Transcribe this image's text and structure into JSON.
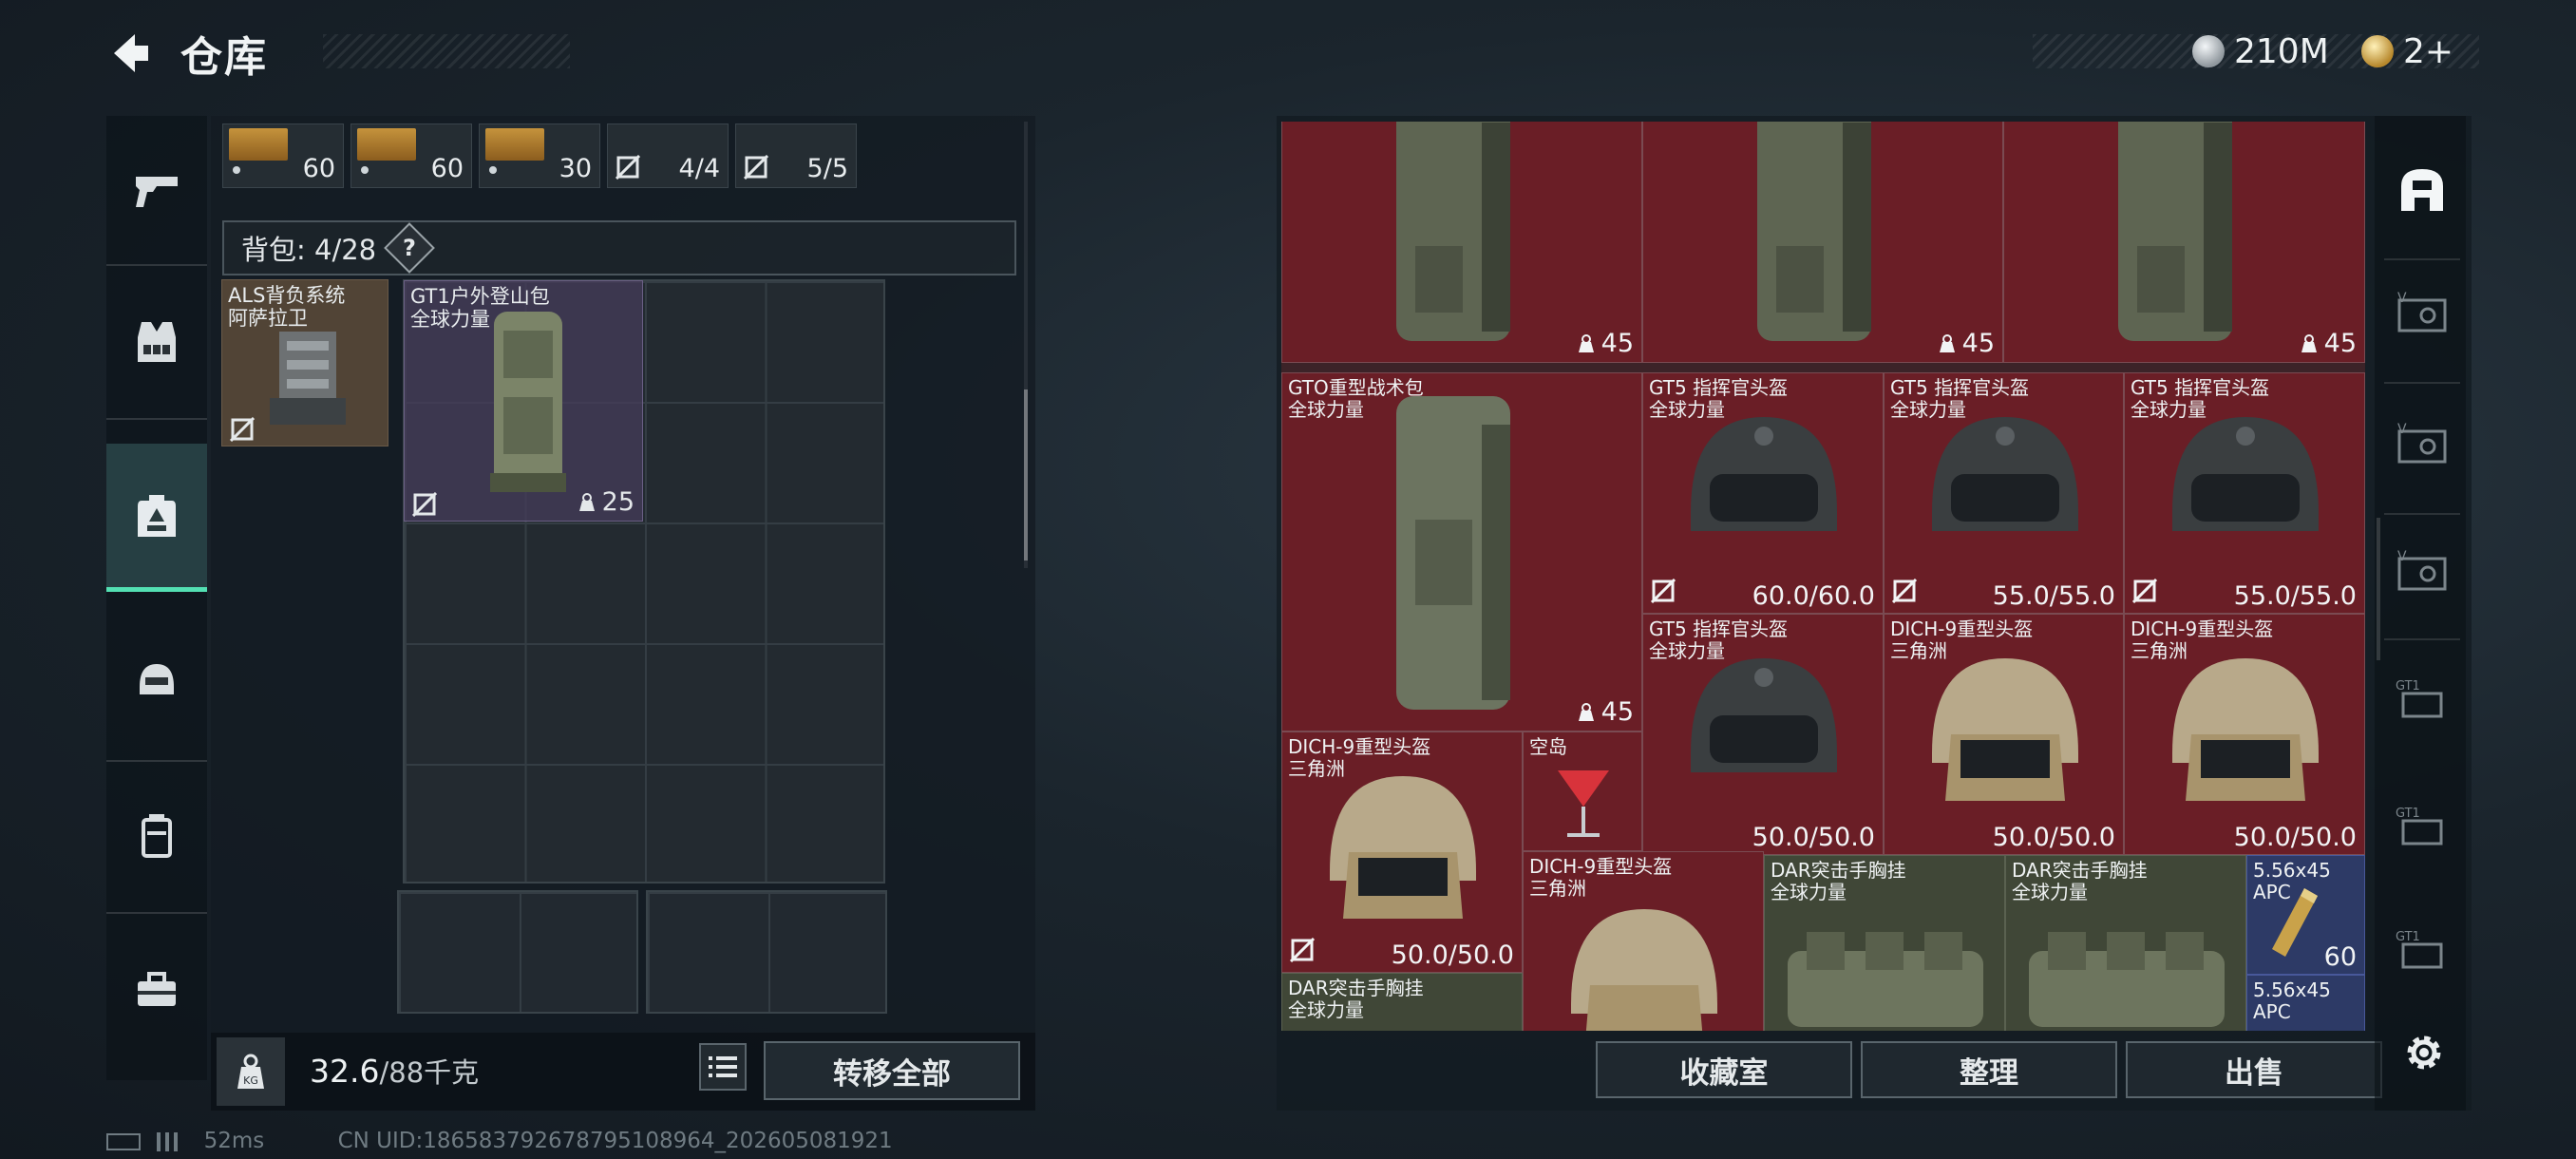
{
  "header": {
    "title": "仓库",
    "currency_silver": "210M",
    "currency_gold": "2+"
  },
  "left_nav": {
    "items": [
      "gun-icon",
      "vest-icon",
      "backpack-icon",
      "helmet-icon",
      "pouch-icon",
      "toolbox-icon"
    ],
    "active_index": 2
  },
  "ammo_row": [
    {
      "qty": "60"
    },
    {
      "qty": "60"
    },
    {
      "qty": "30"
    },
    {
      "qty": "4/4"
    },
    {
      "qty": "5/5"
    }
  ],
  "backpack": {
    "label": "背包: 4/28",
    "help": "?",
    "equipped_name": "ALS背负系统",
    "equipped_sub": "阿萨拉卫",
    "item_name": "GT1户外登山包",
    "item_sub": "全球力量",
    "item_weight": "25"
  },
  "weight": {
    "current": "32.6",
    "max": "/88千克",
    "transfer_label": "转移全部"
  },
  "status": {
    "ping": "52ms",
    "uid": "CN UID:186583792678795108964_202605081921"
  },
  "stash": {
    "items": [
      {
        "weight": "45"
      },
      {
        "weight": "45"
      },
      {
        "weight": "45"
      },
      {
        "name": "GTO重型战术包",
        "sub": "全球力量",
        "weight": "45"
      },
      {
        "name": "GT5 指挥官头盔",
        "sub": "全球力量",
        "durability": "60.0/60.0"
      },
      {
        "name": "GT5 指挥官头盔",
        "sub": "全球力量",
        "durability": "55.0/55.0"
      },
      {
        "name": "GT5 指挥官头盔",
        "sub": "全球力量",
        "durability": "55.0/55.0"
      },
      {
        "name": "GT5 指挥官头盔",
        "sub": "全球力量",
        "durability": "50.0/50.0"
      },
      {
        "name": "DICH-9重型头盔",
        "sub": "三角洲",
        "durability": "50.0/50.0"
      },
      {
        "name": "DICH-9重型头盔",
        "sub": "三角洲",
        "durability": "50.0/50.0"
      },
      {
        "name": "DICH-9重型头盔",
        "sub": "三角洲",
        "durability": "50.0/50.0"
      },
      {
        "name": "空岛"
      },
      {
        "name": "DICH-9重型头盔",
        "sub": "三角洲"
      },
      {
        "name": "DAR突击手胸挂",
        "sub": "全球力量"
      },
      {
        "name": "DAR突击手胸挂",
        "sub": "全球力量"
      },
      {
        "name": "5.56x45",
        "sub": "APC",
        "qty": "60"
      },
      {
        "name": "DAR突击手胸挂",
        "sub": "全球力量"
      },
      {
        "name": "5.56x45",
        "sub": "APC"
      }
    ],
    "buttons": {
      "collection": "收藏室",
      "sort": "整理",
      "sell": "出售"
    }
  },
  "right_tabs": [
    "stash-home-icon",
    "safe-box-icon-1",
    "safe-box-icon-2",
    "safe-box-icon-3",
    "gt1-box-icon-1",
    "gt1-box-icon-2",
    "gt1-box-icon-3"
  ]
}
